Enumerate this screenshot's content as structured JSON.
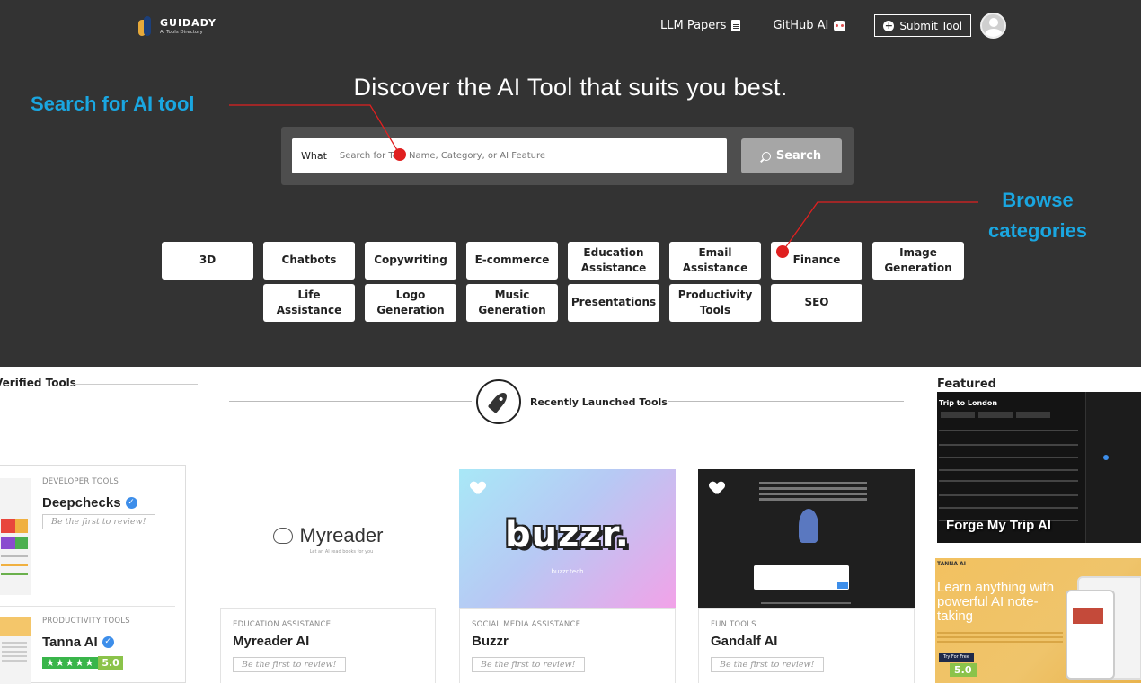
{
  "brand": {
    "name": "GUIDADY",
    "tagline": "AI Tools Directory"
  },
  "nav": {
    "llm_papers": "LLM Papers",
    "github_ai": "GitHub AI",
    "submit_tool": "Submit Tool"
  },
  "hero": {
    "title": "Discover the AI Tool that suits you best."
  },
  "search": {
    "what_label": "What",
    "placeholder": "Search for Tool Name, Category, or AI Feature",
    "button_label": "Search"
  },
  "annotations": {
    "search": "Search for AI tool",
    "browse_line1": "Browse",
    "browse_line2": "categories",
    "accent_color": "#1aa6e0",
    "pointer_color": "#e02020"
  },
  "categories": [
    "3D",
    "Chatbots",
    "Copywriting",
    "E-commerce",
    "Education Assistance",
    "Email Assistance",
    "Finance",
    "Image Generation",
    "Life Assistance",
    "Logo Generation",
    "Music Generation",
    "Presentations",
    "Productivity Tools",
    "SEO"
  ],
  "sections": {
    "verified": "Verified Tools",
    "recent": "Recently Launched Tools",
    "featured": "Featured"
  },
  "verified_tools": [
    {
      "category": "DEVELOPER TOOLS",
      "name": "Deepchecks",
      "review": "Be the first to review!"
    },
    {
      "category": "PRODUCTIVITY TOOLS",
      "name": "Tanna AI",
      "stars": "★★★★★",
      "rating": "5.0"
    }
  ],
  "recent_tools": [
    {
      "category": "EDUCATION ASSISTANCE",
      "name": "Myreader AI",
      "review": "Be the first to review!",
      "logo_text": "Myreader",
      "logo_sub": "Let an AI read books for you"
    },
    {
      "category": "SOCIAL MEDIA ASSISTANCE",
      "name": "Buzzr",
      "review": "Be the first to review!",
      "logo_text": "buzzr.",
      "logo_sub": "buzzr.tech"
    },
    {
      "category": "FUN TOOLS",
      "name": "Gandalf AI",
      "review": "Be the first to review!"
    }
  ],
  "featured": [
    {
      "name": "Forge My Trip AI",
      "screen_title": "Trip to London"
    },
    {
      "name": "Tanna AI",
      "headline": "Learn anything with powerful AI note-taking",
      "brand": "TANNA AI",
      "rating": "5.0",
      "cta": "Try For Free"
    }
  ]
}
